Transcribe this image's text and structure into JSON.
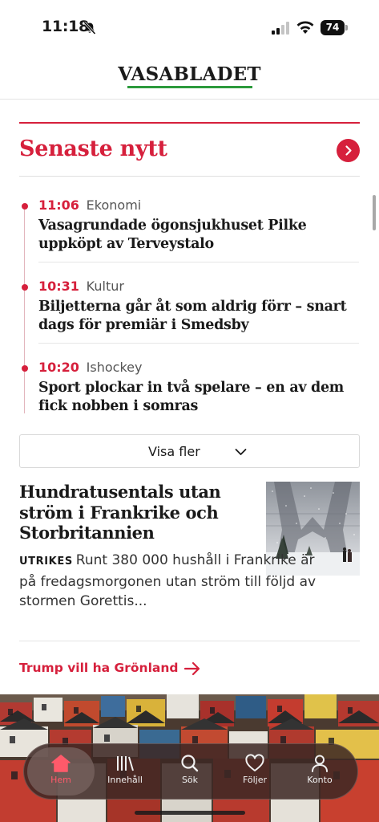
{
  "status_bar": {
    "time": "11:18",
    "battery": "74",
    "icons": [
      "bell-slash-icon",
      "signal-icon",
      "wifi-icon",
      "battery-icon"
    ]
  },
  "header": {
    "logo": "VASABLADET",
    "accent_color": "#2c9a3c"
  },
  "latest_news": {
    "title": "Senaste nytt",
    "accent_color": "#d6203c",
    "items": [
      {
        "time": "11:06",
        "category": "Ekonomi",
        "headline": "Vasagrundade ögonsjukhuset Pilke uppköpt av Terveystalo"
      },
      {
        "time": "10:31",
        "category": "Kultur",
        "headline": "Biljetterna går åt som aldrig förr – snart dags för premiär i Smedsby"
      },
      {
        "time": "10:20",
        "category": "Ishockey",
        "headline": "Sport plockar in två spelare – en av dem fick nobben i somras"
      }
    ],
    "show_more_label": "Visa fler"
  },
  "article": {
    "title": "Hundratusentals utan ström i Frankrike och Storbritannien",
    "kicker": "UTRIKES",
    "summary": "Runt 380 000 hushåll i Frankrike är på fredagsmorgonen utan ström till följd av stormen Gorettis..."
  },
  "promo_link": {
    "label": "Trump vill ha Grönland"
  },
  "tab_bar": {
    "tabs": [
      {
        "label": "Hem",
        "icon": "home-icon",
        "active": true
      },
      {
        "label": "Innehåll",
        "icon": "library-icon",
        "active": false
      },
      {
        "label": "Sök",
        "icon": "search-icon",
        "active": false
      },
      {
        "label": "Följer",
        "icon": "heart-icon",
        "active": false
      },
      {
        "label": "Konto",
        "icon": "user-icon",
        "active": false
      }
    ]
  }
}
